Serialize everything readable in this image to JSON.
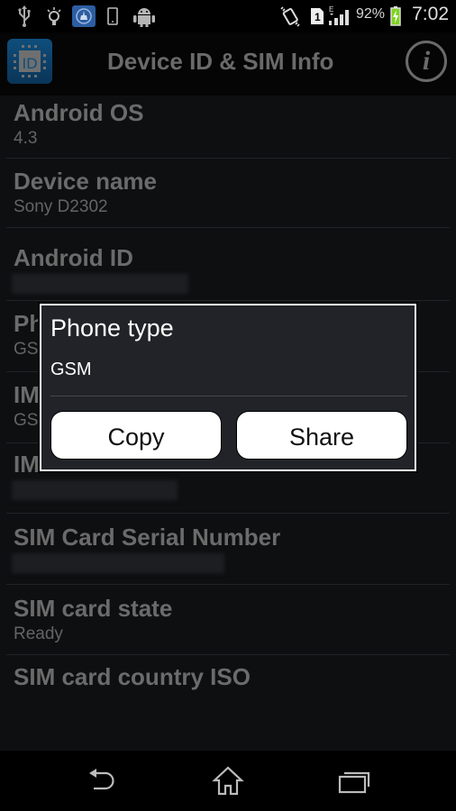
{
  "status_bar": {
    "left_icons": [
      "usb-icon",
      "lightbulb-icon",
      "cleaner-app-icon",
      "phone-outline-icon",
      "android-icon"
    ],
    "right_icons": [
      "vibrate-icon",
      "sim-1-icon",
      "signal-e-icon",
      "battery-charging-icon"
    ],
    "battery": "92%",
    "time": "7:02",
    "network_type": "E",
    "sim_slot": "1"
  },
  "action_bar": {
    "title": "Device ID & SIM Info",
    "app_icon_text": "ID",
    "info_glyph": "i"
  },
  "list": {
    "items": [
      {
        "label": "Android OS",
        "value": "4.3"
      },
      {
        "label": "Device name",
        "value": "Sony D2302"
      },
      {
        "label": "Android ID",
        "value": null,
        "redacted": true
      },
      {
        "label": "Phone type",
        "value": "GSM"
      },
      {
        "label": "IMEI",
        "value": "GSM"
      },
      {
        "label": "IMSI",
        "value": null,
        "redacted": true
      },
      {
        "label": "SIM Card Serial Number",
        "value": null,
        "redacted": true
      },
      {
        "label": "SIM card state",
        "value": "Ready"
      },
      {
        "label": "SIM card country ISO",
        "value": null
      }
    ]
  },
  "dialog": {
    "title": "Phone type",
    "value": "GSM",
    "copy_label": "Copy",
    "share_label": "Share"
  },
  "nav_bar": {
    "buttons": [
      "back-icon",
      "home-icon",
      "recents-icon"
    ]
  },
  "colors": {
    "app_icon_blue": "#0f4e7c",
    "battery_green": "#7ed321",
    "dialog_bg": "#212328"
  }
}
